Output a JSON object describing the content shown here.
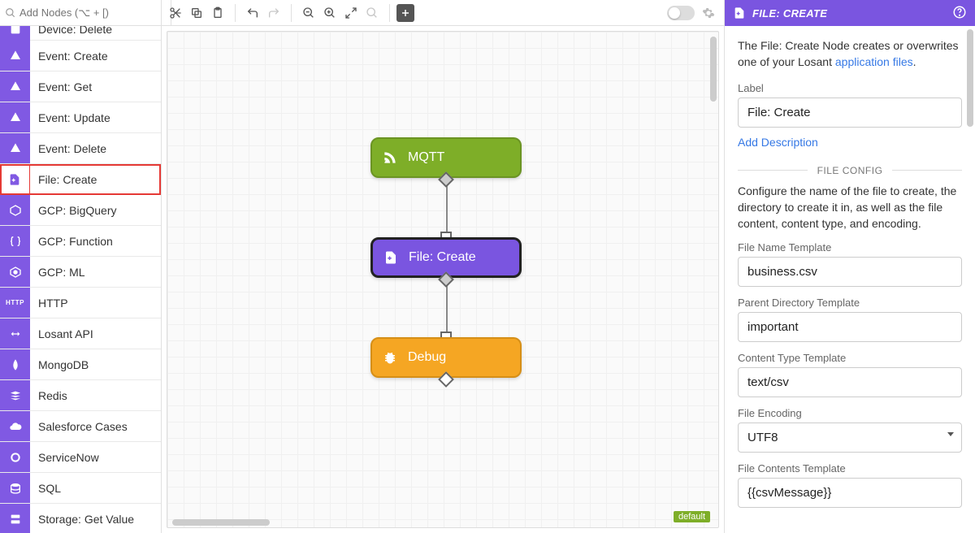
{
  "search": {
    "placeholder": "Add Nodes (⌥ + [)"
  },
  "sidebar": {
    "items": [
      {
        "label": "Device: Delete",
        "icon": "device"
      },
      {
        "label": "Event: Create",
        "icon": "event"
      },
      {
        "label": "Event: Get",
        "icon": "event"
      },
      {
        "label": "Event: Update",
        "icon": "event"
      },
      {
        "label": "Event: Delete",
        "icon": "event"
      },
      {
        "label": "File: Create",
        "icon": "file",
        "highlight": true
      },
      {
        "label": "GCP: BigQuery",
        "icon": "gcp-bq"
      },
      {
        "label": "GCP: Function",
        "icon": "gcp-fn"
      },
      {
        "label": "GCP: ML",
        "icon": "gcp-ml"
      },
      {
        "label": "HTTP",
        "icon": "http"
      },
      {
        "label": "Losant API",
        "icon": "api"
      },
      {
        "label": "MongoDB",
        "icon": "mongo"
      },
      {
        "label": "Redis",
        "icon": "redis"
      },
      {
        "label": "Salesforce Cases",
        "icon": "cloud"
      },
      {
        "label": "ServiceNow",
        "icon": "servicenow"
      },
      {
        "label": "SQL",
        "icon": "sql"
      },
      {
        "label": "Storage: Get Value",
        "icon": "storage"
      }
    ]
  },
  "canvas": {
    "nodes": {
      "mqtt": "MQTT",
      "file": "File: Create",
      "debug": "Debug"
    },
    "badge": "default"
  },
  "panel": {
    "title": "FILE: CREATE",
    "desc_pre": "The File: Create Node creates or overwrites one of your Losant ",
    "desc_link": "application files",
    "desc_post": ".",
    "label_caption": "Label",
    "label_value": "File: Create",
    "add_description": "Add Description",
    "section": "FILE CONFIG",
    "config_desc": "Configure the name of the file to create, the directory to create it in, as well as the file content, content type, and encoding.",
    "file_name_caption": "File Name Template",
    "file_name_value": "business.csv",
    "parent_dir_caption": "Parent Directory Template",
    "parent_dir_value": "important",
    "content_type_caption": "Content Type Template",
    "content_type_value": "text/csv",
    "encoding_caption": "File Encoding",
    "encoding_value": "UTF8",
    "contents_caption": "File Contents Template",
    "contents_value": "{{csvMessage}}"
  }
}
